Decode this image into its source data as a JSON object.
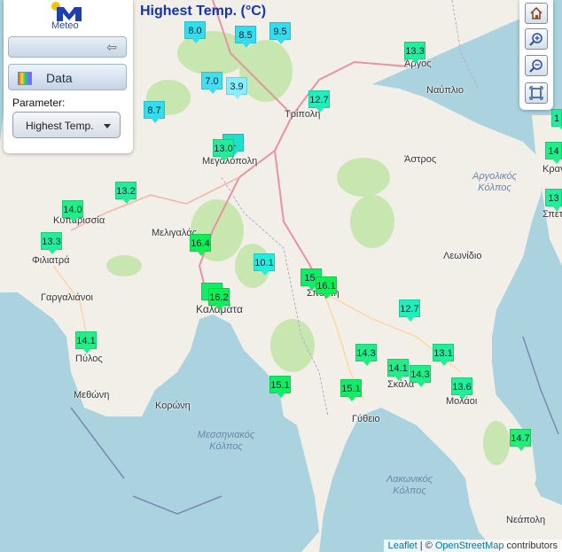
{
  "app": {
    "logo_text": "Meteo",
    "map_title": "Highest Temp. (°C)"
  },
  "panel": {
    "data_label": "Data",
    "parameter_label": "Parameter:",
    "parameter_value": "Highest Temp."
  },
  "toolbar": {
    "home_icon": "home-icon",
    "zoom_in_icon": "zoom-in-icon",
    "zoom_out_icon": "zoom-out-icon",
    "fit_icon": "fit-extent-icon"
  },
  "places": [
    {
      "name": "Τρίπολη"
    },
    {
      "name": "Άργος"
    },
    {
      "name": "Ναύπλιο"
    },
    {
      "name": "Άστρος"
    },
    {
      "name": "Μεγαλόπολη"
    },
    {
      "name": "Κυπαρισσία"
    },
    {
      "name": "Μελιγαλάς"
    },
    {
      "name": "Φιλιατρά"
    },
    {
      "name": "Γαργαλιάνοι"
    },
    {
      "name": "Καλαμάτα"
    },
    {
      "name": "Σπάρτη"
    },
    {
      "name": "Λεωνίδιο"
    },
    {
      "name": "Πύλος"
    },
    {
      "name": "Μεθώνη"
    },
    {
      "name": "Κορώνη"
    },
    {
      "name": "Σκάλα"
    },
    {
      "name": "Μολάοι"
    },
    {
      "name": "Γύθειο"
    },
    {
      "name": "Νεάπολη"
    },
    {
      "name": "Κρανίδι"
    },
    {
      "name": "Σπέτσες"
    }
  ],
  "sea_labels": [
    {
      "text": "Αργολικός Κόλπος"
    },
    {
      "text": "Μεσσηνιακός Κόλπος"
    },
    {
      "text": "Λακωνικός Κόλπος"
    }
  ],
  "stations": [
    {
      "value": "8.0",
      "color": "#33ddee"
    },
    {
      "value": "8.5",
      "color": "#33ddee"
    },
    {
      "value": "9.5",
      "color": "#33ddee"
    },
    {
      "value": "13.3",
      "color": "#22ee99"
    },
    {
      "value": "7.0",
      "color": "#44ddee"
    },
    {
      "value": "3.9",
      "color": "#88eeff"
    },
    {
      "value": "8.7",
      "color": "#33ddee"
    },
    {
      "value": "12.7",
      "color": "#22eebb"
    },
    {
      "value": "13.0",
      "color": "#22ee99"
    },
    {
      "value": "1",
      "color": "#22ddcc"
    },
    {
      "value": "13.2",
      "color": "#22ee99"
    },
    {
      "value": "14.0",
      "color": "#22ee88"
    },
    {
      "value": "13.3",
      "color": "#22ee99"
    },
    {
      "value": "16.4",
      "color": "#11ee55"
    },
    {
      "value": "10.1",
      "color": "#22eedd"
    },
    {
      "value": "15.",
      "color": "#11ee66"
    },
    {
      "value": "16.1",
      "color": "#11ee55"
    },
    {
      "value": "1",
      "color": "#11ee66"
    },
    {
      "value": "16.2",
      "color": "#11ee55"
    },
    {
      "value": "12.7",
      "color": "#22eebb"
    },
    {
      "value": "14.1",
      "color": "#22ee88"
    },
    {
      "value": "14.3",
      "color": "#22ee88"
    },
    {
      "value": "13.1",
      "color": "#22ee99"
    },
    {
      "value": "14.1",
      "color": "#22ee88"
    },
    {
      "value": "14.3",
      "color": "#22ee88"
    },
    {
      "value": "15.1",
      "color": "#11ee66"
    },
    {
      "value": "15.1",
      "color": "#11ee66"
    },
    {
      "value": "13.6",
      "color": "#22ee99"
    },
    {
      "value": "14.7",
      "color": "#22ee77"
    },
    {
      "value": "1",
      "color": "#22ee99"
    },
    {
      "value": "14",
      "color": "#22ee88"
    },
    {
      "value": "13",
      "color": "#22ee99"
    }
  ],
  "attribution": {
    "leaflet": "Leaflet",
    "sep": " | © ",
    "osm": "OpenStreetMap",
    "contrib": " contributors"
  },
  "colors": {
    "land": "#f2efe9",
    "sea": "#aad3df",
    "forest": "#c8e6b0",
    "title": "#1533b8"
  }
}
